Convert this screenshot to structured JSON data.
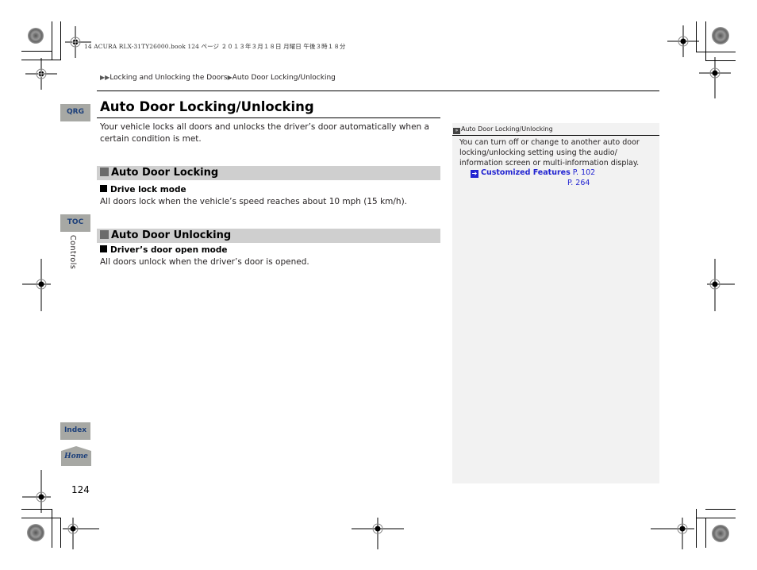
{
  "print_header": "14 ACURA RLX-31TY26000.book  124 ページ  ２０１３年３月１８日  月曜日  午後３時１８分",
  "breadcrumb": {
    "prefix": "▶▶",
    "items": [
      "Locking and Unlocking the Doors",
      "Auto Door Locking/Unlocking"
    ],
    "separator": "▶"
  },
  "side_tabs": {
    "qrg": "QRG",
    "toc": "TOC",
    "index": "Index",
    "home": "Home",
    "chapter": "Controls"
  },
  "page": {
    "title": "Auto Door Locking/Unlocking",
    "intro": "Your vehicle locks all doors and unlocks the driver’s door automatically when a certain condition is met.",
    "number": "124"
  },
  "sections": [
    {
      "heading": "Auto Door Locking",
      "subheading": "Drive lock mode",
      "body": "All doors lock when the vehicle’s speed reaches about 10 mph (15 km/h)."
    },
    {
      "heading": "Auto Door Unlocking",
      "subheading": "Driver’s door open mode",
      "body": "All doors unlock when the driver’s door is opened."
    }
  ],
  "note": {
    "title": "Auto Door Locking/Unlocking",
    "body": "You can turn off or change to another auto door locking/unlocking setting using the audio/ information screen or multi-information display.",
    "link_label": "Customized Features",
    "link_pages": [
      "P. 102",
      "P. 264"
    ]
  },
  "colors": {
    "tab_bg": "#a7a8a4",
    "tab_text": "#1c3f7a",
    "section_bar": "#cfcfcf",
    "note_bg": "#f2f2f2",
    "link": "#2224d1"
  }
}
